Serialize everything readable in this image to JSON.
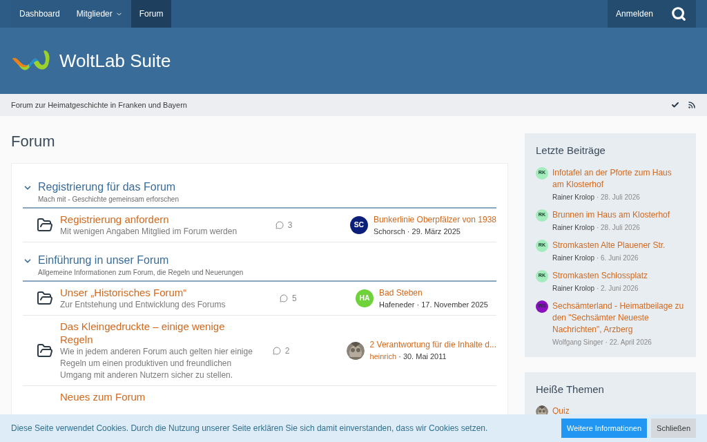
{
  "nav": {
    "items": [
      {
        "label": "Dashboard",
        "selected": false,
        "dropdown": false
      },
      {
        "label": "Mitglieder",
        "selected": false,
        "dropdown": true
      },
      {
        "label": "Forum",
        "selected": true,
        "dropdown": false
      }
    ],
    "login": "Anmelden"
  },
  "logo": {
    "text": "WoltLab Suite"
  },
  "breadcrumb": "Forum zur Heimatgeschichte in Franken und Bayern",
  "page_title": "Forum",
  "categories": [
    {
      "title": "Registrierung für das Forum",
      "subtitle": "Mach mit - Geschichte gemeinsam erforschen",
      "expanded": true,
      "boards": [
        {
          "title": "Registrierung anfordern",
          "description": "Mit wenigen Angaben Mitglied im Forum werden",
          "posts": "3",
          "last": {
            "title": "Bunkerlinie Oberpfälzer von 1938",
            "author": "Schorsch",
            "author_link": false,
            "separator": "·",
            "date": "29. März 2025",
            "avatar": {
              "kind": "initials",
              "text": "SC",
              "color": "#0b1f7a"
            }
          }
        }
      ]
    },
    {
      "title": "Einführung in unser Forum",
      "subtitle": "Allgemeine Informationen zum Forum, die Regeln und Neuerungen",
      "expanded": true,
      "boards": [
        {
          "title": "Unser „Historisches Forum“",
          "description": "Zur Entstehung und Entwicklung des Forums",
          "posts": "5",
          "last": {
            "title": "Bad Steben",
            "author": "Hafeneder",
            "author_link": false,
            "separator": "·",
            "date": "17. November 2025",
            "avatar": {
              "kind": "initials",
              "text": "HA",
              "color": "#6fd23a"
            }
          }
        },
        {
          "title": "Das Kleingedruckte – einige wenige Regeln",
          "description": "Wie in jedem anderen Forum auch gelten hier einige Regeln um einen produktiven und freundlichen Umgang mit anderen Nutzern sicher zu stellen.",
          "posts": "2",
          "last": {
            "title": "2 Verantwortung für die Inhalte d...",
            "author": "heinrich",
            "author_link": true,
            "separator": "·",
            "date": "30. Mai 2011"
          }
        },
        {
          "title": "Neues zum Forum"
        }
      ]
    }
  ],
  "sidebar": [
    {
      "title": "Letzte Beiträge",
      "items": [
        {
          "title": "Infotafel an der Pforte zum Haus am Klosterhof",
          "author": "Rainer Krolop",
          "author_muted": false,
          "separator": "·",
          "date": "28. Juli 2026",
          "avatar": {
            "kind": "initials",
            "text": "RK",
            "color": "#a3ecbc"
          }
        },
        {
          "title": "Brunnen im Haus am Klosterhof",
          "author": "Rainer Krolop",
          "author_muted": false,
          "separator": "·",
          "date": "28. Juli 2026",
          "avatar": {
            "kind": "initials",
            "text": "RK",
            "color": "#a3ecbc"
          }
        },
        {
          "title": "Stromkasten Alte Plauener Str.",
          "author": "Rainer Krolop",
          "author_muted": false,
          "separator": "·",
          "date": "6. Juni 2026",
          "avatar": {
            "kind": "initials",
            "text": "RK",
            "color": "#a3ecbc"
          }
        },
        {
          "title": "Stromkasten Schlossplatz",
          "author": "Rainer Krolop",
          "author_muted": false,
          "separator": "·",
          "date": "2. Juni 2026",
          "avatar": {
            "kind": "initials",
            "text": "RK",
            "color": "#a3ecbc"
          }
        },
        {
          "title": "Sechsämterland - Heimatbeilage zu den \"Sechsämter Neueste Nachrichten\", Arzberg",
          "author": "Wolfgang Singer",
          "author_muted": true,
          "separator": "·",
          "date": "22. April 2026",
          "avatar": {
            "kind": "initials",
            "text": "WS",
            "color": "#8a0fbf"
          }
        }
      ]
    },
    {
      "title": "Heiße Themen",
      "items": [
        {
          "title": "Quiz"
        }
      ]
    }
  ],
  "cookie": {
    "text": "Diese Seite verwendet Cookies. Durch die Nutzung unserer Seite erklären Sie sich damit einverstanden, dass wir Cookies setzen.",
    "buttons": [
      {
        "label": "Weitere Informationen",
        "kind": "primary"
      },
      {
        "label": "Schließen",
        "kind": "secondary"
      }
    ]
  }
}
